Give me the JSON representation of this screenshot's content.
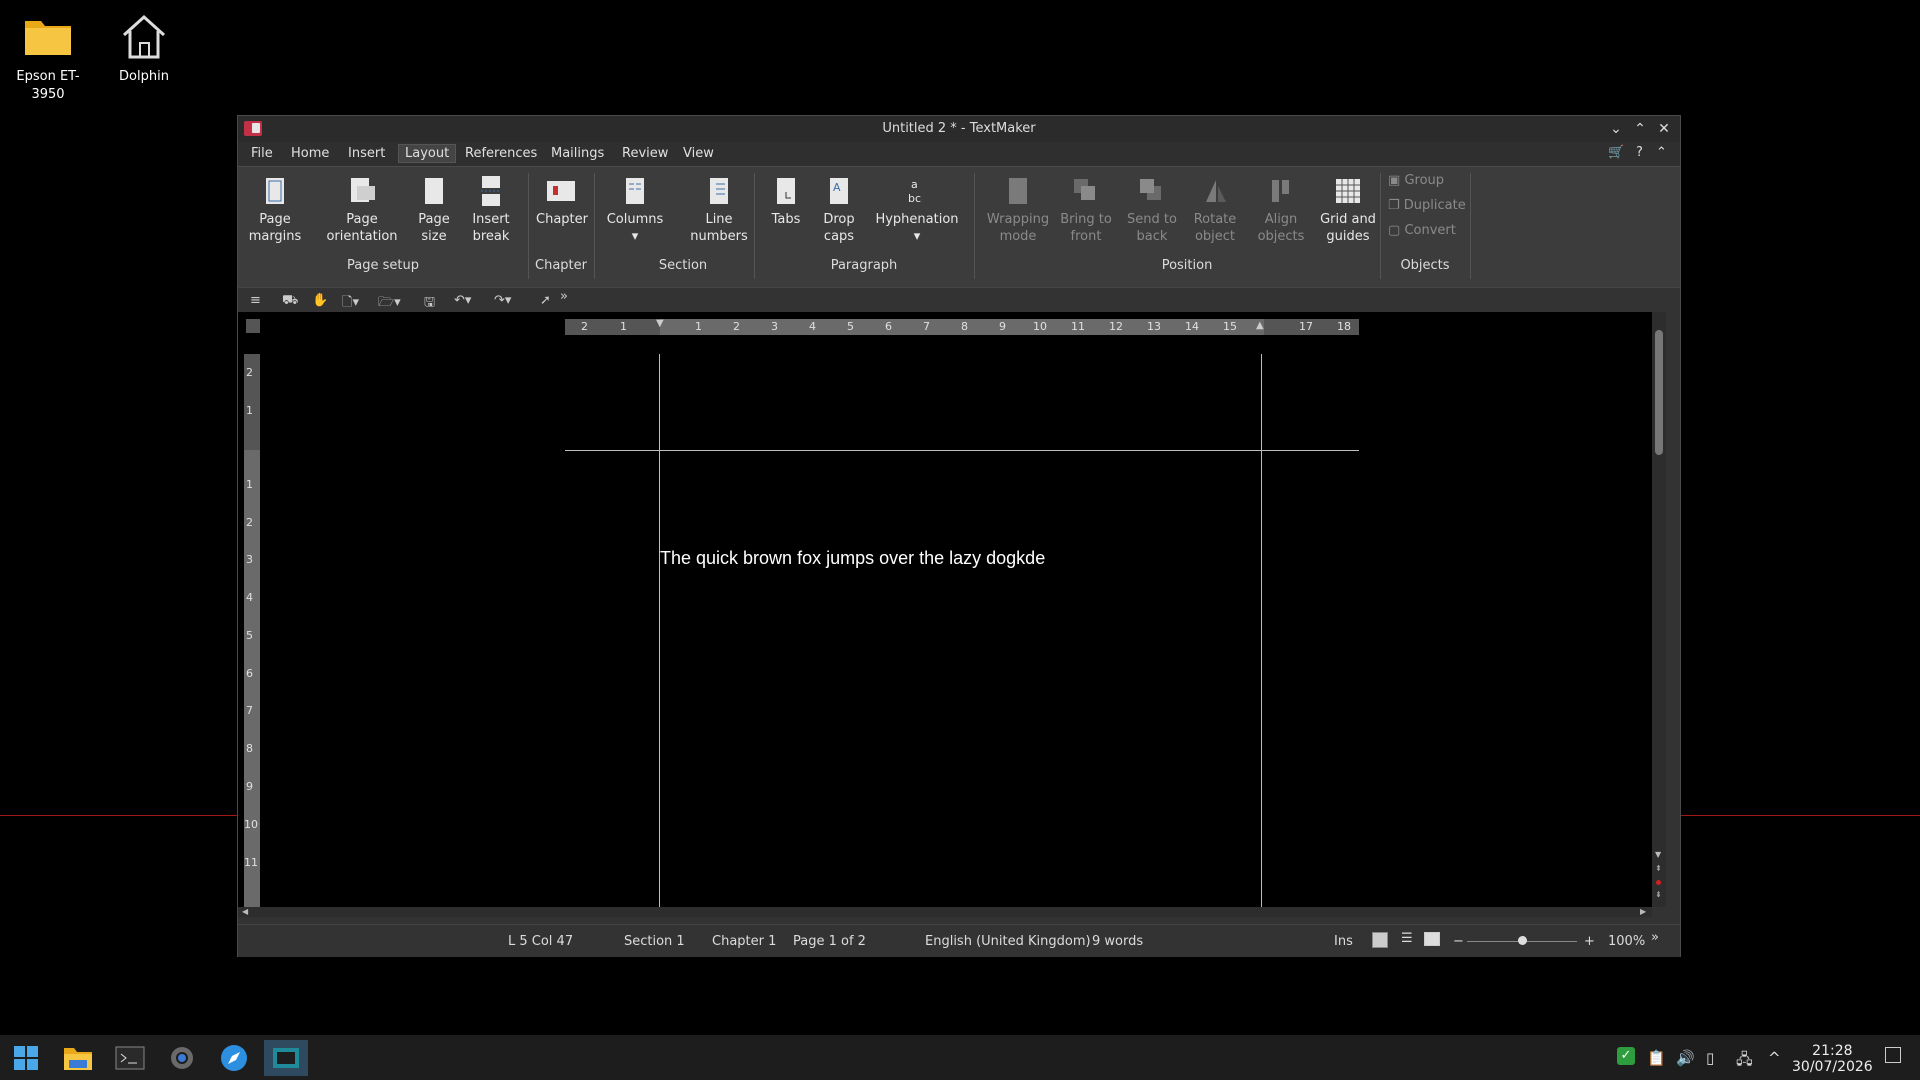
{
  "desktop": {
    "icons": [
      {
        "label": "Epson ET-\n3950",
        "name": "epson-folder"
      },
      {
        "label": "Dolphin",
        "name": "dolphin"
      }
    ]
  },
  "window": {
    "title": "Untitled 2 * - TextMaker",
    "menu": [
      "File",
      "Home",
      "Insert",
      "Layout",
      "References",
      "Mailings",
      "Review",
      "View"
    ],
    "active_menu": "Layout"
  },
  "ribbon": {
    "page_margins": "Page\nmargins",
    "page_orientation": "Page\norientation",
    "page_size": "Page\nsize",
    "insert_break": "Insert\nbreak",
    "chapter": "Chapter",
    "columns": "Columns",
    "line_numbers": "Line\nnumbers",
    "tabs": "Tabs",
    "drop_caps": "Drop\ncaps",
    "hyphenation": "Hyphenation",
    "wrapping_mode": "Wrapping\nmode",
    "bring_to_front": "Bring to\nfront",
    "send_to_back": "Send to\nback",
    "rotate_object": "Rotate\nobject",
    "align_objects": "Align\nobjects",
    "grid_and_guides": "Grid and\nguides",
    "group": "Group",
    "duplicate": "Duplicate",
    "convert": "Convert",
    "groups": {
      "page_setup": "Page setup",
      "chapter": "Chapter",
      "section": "Section",
      "paragraph": "Paragraph",
      "position": "Position",
      "objects": "Objects"
    }
  },
  "ruler": {
    "h_labels": [
      "2",
      "1",
      "1",
      "2",
      "3",
      "4",
      "5",
      "6",
      "7",
      "8",
      "9",
      "10",
      "11",
      "12",
      "13",
      "14",
      "15",
      "17",
      "18"
    ],
    "v_labels": [
      "2",
      "1",
      "1",
      "2",
      "3",
      "4",
      "5",
      "6",
      "7",
      "8",
      "9",
      "10",
      "11"
    ]
  },
  "document": {
    "text": "The quick brown fox jumps over the lazy dogkde"
  },
  "status": {
    "position": "L 5 Col 47",
    "section": "Section 1",
    "chapter": "Chapter 1",
    "page": "Page 1 of 2",
    "language": "English (United Kingdom)",
    "words": "9 words",
    "mode": "Ins",
    "zoom": "100%"
  },
  "taskbar": {
    "time": "21:28",
    "date": "30/07/2026"
  }
}
